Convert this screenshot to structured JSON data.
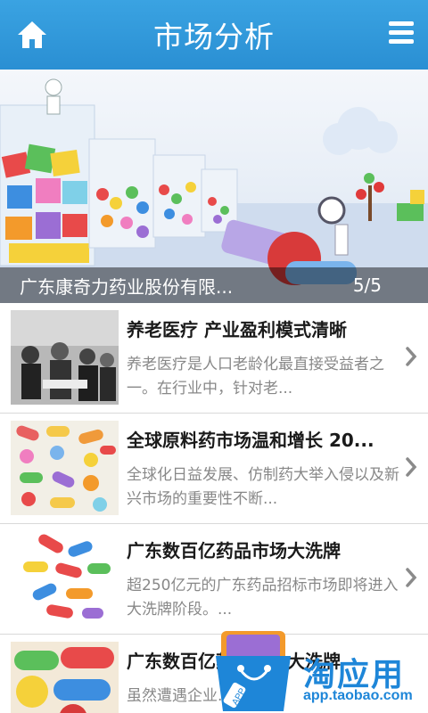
{
  "header": {
    "title": "市场分析",
    "home_icon": "home-icon",
    "menu_icon": "menu-icon",
    "background": "#2f97da"
  },
  "banner": {
    "caption": "广东康奇力药业股份有限...",
    "counter": "5/5"
  },
  "articles": [
    {
      "title": "养老医疗 产业盈利模式清晰",
      "desc": "养老医疗是人口老龄化最直接受益者之一。在行业中，针对老...",
      "thumb": "elderly-people-photo"
    },
    {
      "title": "全球原料药市场温和增长 20...",
      "desc": "全球化日益发展、仿制药大举入侵以及新兴市场的重要性不断...",
      "thumb": "colorful-pills-photo"
    },
    {
      "title": "广东数百亿药品市场大洗牌",
      "desc": "超250亿元的广东药品招标市场即将进入大洗牌阶段。...",
      "thumb": "capsules-photo"
    },
    {
      "title": "广东数百亿药品市场大洗牌",
      "desc": "虽然遭遇企业...",
      "thumb": "pills-closeup-photo"
    }
  ],
  "watermark": {
    "brand": "淘应用",
    "url": "app.taobao.com",
    "badge": "APP"
  }
}
